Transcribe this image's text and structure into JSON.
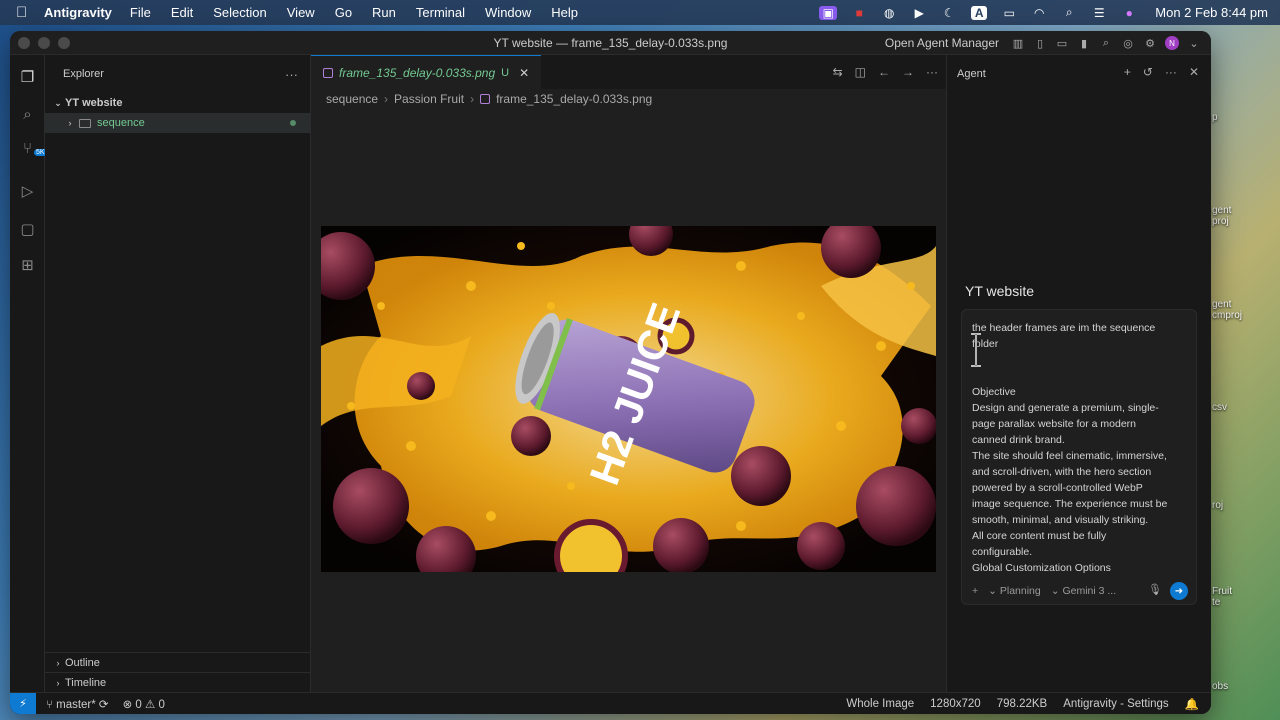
{
  "menubar": {
    "app": "Antigravity",
    "items": [
      "File",
      "Edit",
      "Selection",
      "View",
      "Go",
      "Run",
      "Terminal",
      "Window",
      "Help"
    ],
    "clock": "Mon 2 Feb  8:44 pm"
  },
  "window": {
    "title": "YT website — frame_135_delay-0.033s.png",
    "open_agent_manager": "Open Agent Manager",
    "avatar_initial": "N"
  },
  "activity": {
    "badge": "5K+"
  },
  "sidebar": {
    "title": "Explorer",
    "root": "YT website",
    "child": "sequence",
    "outline": "Outline",
    "timeline": "Timeline"
  },
  "editor": {
    "tab_name": "frame_135_delay-0.033s.png",
    "tab_status": "U",
    "breadcrumb": [
      "sequence",
      "Passion Fruit",
      "frame_135_delay-0.033s.png"
    ],
    "can_label": "H2 JUICE"
  },
  "agent": {
    "title": "Agent",
    "workspace": "YT website",
    "text_lines": [
      "the header frames are im the sequence",
      "folder",
      "",
      "Objective",
      "Design and generate a premium, single-",
      "page parallax website for a modern",
      "canned drink brand.",
      "The site should feel cinematic, immersive,",
      "and scroll-driven, with the hero section",
      "powered by a scroll-controlled WebP",
      "image sequence. The experience must be",
      "smooth, minimal, and visually striking.",
      "All core content must be fully",
      "configurable.",
      "Global Customization Options"
    ],
    "mode": "Planning",
    "model": "Gemini 3 ..."
  },
  "statusbar": {
    "branch": "master*",
    "errors": "0",
    "warnings": "0",
    "view": "Whole Image",
    "dims": "1280x720",
    "size": "798.22KB",
    "settings": "Antigravity - Settings"
  },
  "desktop": {
    "labels": [
      "p",
      "gent\nproj",
      "gent\ncmproj",
      "csv",
      "roj",
      "Fruit\nte",
      "obs"
    ]
  },
  "colors": {
    "accent": "#0e7ad1",
    "git_added": "#73c991",
    "juice": "#f4b21f"
  }
}
